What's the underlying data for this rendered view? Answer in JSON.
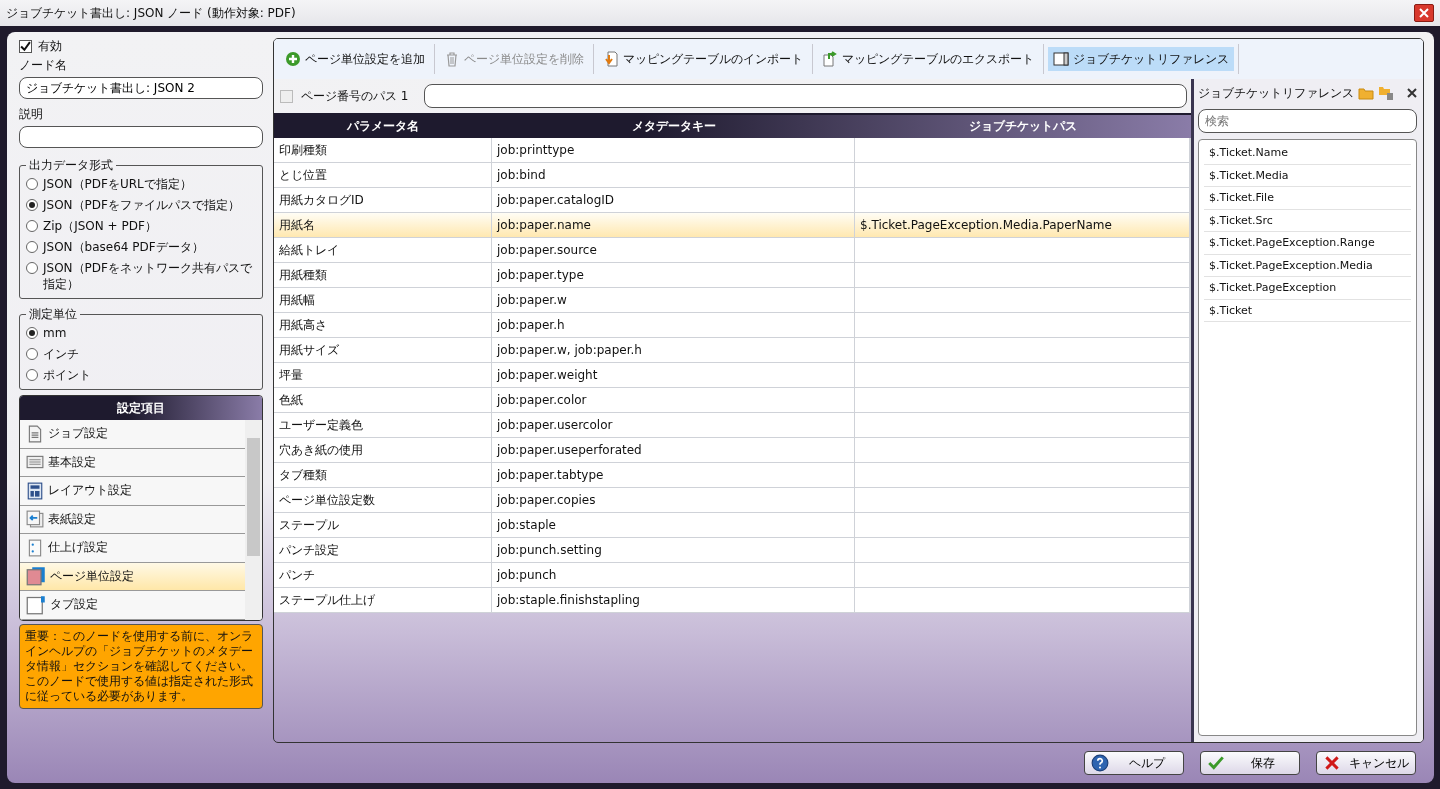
{
  "window": {
    "title": "ジョブチケット書出し: JSON ノード (動作対象: PDF)"
  },
  "enabled": {
    "label": "有効",
    "checked": true
  },
  "node_name": {
    "label": "ノード名",
    "value": "ジョブチケット書出し: JSON 2"
  },
  "description": {
    "label": "説明"
  },
  "output_format": {
    "title": "出力データ形式",
    "options": [
      {
        "label": "JSON（PDFをURLで指定）",
        "selected": false
      },
      {
        "label": "JSON（PDFをファイルパスで指定）",
        "selected": true
      },
      {
        "label": "Zip（JSON + PDF）",
        "selected": false
      },
      {
        "label": "JSON（base64 PDFデータ）",
        "selected": false
      },
      {
        "label": "JSON（PDFをネットワーク共有パスで指定）",
        "selected": false
      }
    ]
  },
  "units": {
    "title": "測定単位",
    "options": [
      {
        "label": "mm",
        "selected": true
      },
      {
        "label": "インチ",
        "selected": false
      },
      {
        "label": "ポイント",
        "selected": false
      }
    ]
  },
  "settings": {
    "title": "設定項目",
    "items": [
      {
        "label": "ジョブ設定",
        "kind": "document",
        "selected": false
      },
      {
        "label": "基本設定",
        "kind": "list",
        "selected": false
      },
      {
        "label": "レイアウト設定",
        "kind": "layout",
        "selected": false
      },
      {
        "label": "表紙設定",
        "kind": "cover",
        "selected": false
      },
      {
        "label": "仕上げ設定",
        "kind": "finish",
        "selected": false
      },
      {
        "label": "ページ単位設定",
        "kind": "pages",
        "selected": true
      },
      {
        "label": "タブ設定",
        "kind": "tab",
        "selected": false
      }
    ]
  },
  "notice": "重要：このノードを使用する前に、オンラインヘルプの「ジョブチケットのメタデータ情報」セクションを確認してください。このノードで使用する値は指定された形式に従っている必要があります。",
  "toolbar": [
    {
      "label": "ページ単位設定を追加",
      "kind": "add",
      "disabled": false,
      "selected": false
    },
    {
      "label": "ページ単位設定を削除",
      "kind": "delete",
      "disabled": true,
      "selected": false
    },
    {
      "label": "マッピングテーブルのインポート",
      "kind": "import",
      "disabled": false,
      "selected": false
    },
    {
      "label": "マッピングテーブルのエクスポート",
      "kind": "export",
      "disabled": false,
      "selected": false
    },
    {
      "label": "ジョブチケットリファレンス",
      "kind": "reference",
      "disabled": false,
      "selected": true
    }
  ],
  "page_path": {
    "label": "ページ番号のパス 1",
    "checked": false
  },
  "table": {
    "columns": [
      "パラメータ名",
      "メタデータキー",
      "ジョブチケットパス"
    ],
    "rows": [
      {
        "cells": [
          "印刷種類",
          "job:printtype"
        ],
        "selected": false
      },
      {
        "cells": [
          "とじ位置",
          "job:bind"
        ],
        "selected": false
      },
      {
        "cells": [
          "用紙カタログID",
          "job:paper.catalogID"
        ],
        "selected": false
      },
      {
        "cells": [
          "用紙名",
          "job:paper.name",
          "$.Ticket.PageException.Media.PaperName"
        ],
        "selected": true
      },
      {
        "cells": [
          "給紙トレイ",
          "job:paper.source"
        ],
        "selected": false
      },
      {
        "cells": [
          "用紙種類",
          "job:paper.type"
        ],
        "selected": false
      },
      {
        "cells": [
          "用紙幅",
          "job:paper.w"
        ],
        "selected": false
      },
      {
        "cells": [
          "用紙高さ",
          "job:paper.h"
        ],
        "selected": false
      },
      {
        "cells": [
          "用紙サイズ",
          "job:paper.w, job:paper.h"
        ],
        "selected": false
      },
      {
        "cells": [
          "坪量",
          "job:paper.weight"
        ],
        "selected": false
      },
      {
        "cells": [
          "色紙",
          "job:paper.color"
        ],
        "selected": false
      },
      {
        "cells": [
          "ユーザー定義色",
          "job:paper.usercolor"
        ],
        "selected": false
      },
      {
        "cells": [
          "穴あき紙の使用",
          "job:paper.useperforated"
        ],
        "selected": false
      },
      {
        "cells": [
          "タブ種類",
          "job:paper.tabtype"
        ],
        "selected": false
      },
      {
        "cells": [
          "ページ単位設定数",
          "job:paper.copies"
        ],
        "selected": false
      },
      {
        "cells": [
          "ステープル",
          "job:staple"
        ],
        "selected": false
      },
      {
        "cells": [
          "パンチ設定",
          "job:punch.setting"
        ],
        "selected": false
      },
      {
        "cells": [
          "パンチ",
          "job:punch"
        ],
        "selected": false
      },
      {
        "cells": [
          "ステープル仕上げ",
          "job:staple.finishstapling"
        ],
        "selected": false
      }
    ]
  },
  "reference": {
    "title": "ジョブチケットリファレンス",
    "search_placeholder": "検索",
    "items": [
      "$.Ticket.Name",
      "$.Ticket.Media",
      "$.Ticket.File",
      "$.Ticket.Src",
      "$.Ticket.PageException.Range",
      "$.Ticket.PageException.Media",
      "$.Ticket.PageException",
      "$.Ticket"
    ]
  },
  "buttons": [
    {
      "label": "ヘルプ",
      "kind": "help"
    },
    {
      "label": "保存",
      "kind": "save"
    },
    {
      "label": "キャンセル",
      "kind": "cancel"
    }
  ]
}
